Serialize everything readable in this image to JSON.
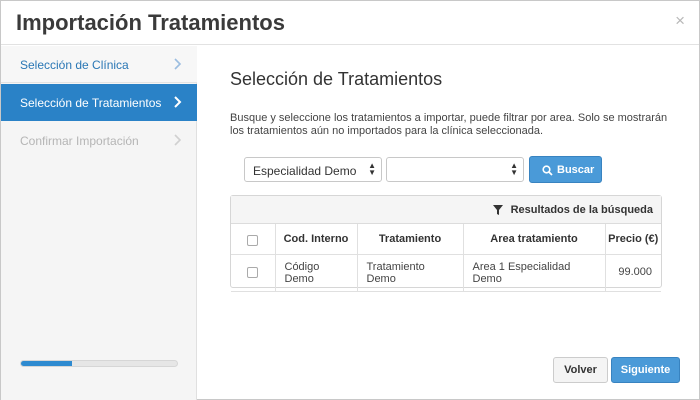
{
  "window": {
    "title": "Importación Tratamientos",
    "close_glyph": "×"
  },
  "sidebar": {
    "steps": [
      {
        "label": "Selección de Clínica",
        "state": "done"
      },
      {
        "label": "Selección de Tratamientos",
        "state": "active"
      },
      {
        "label": "Confirmar Importación",
        "state": "disabled"
      }
    ],
    "progress_percent": 33
  },
  "main": {
    "title": "Selección de Tratamientos",
    "description": "Busque y seleccione los tratamientos a importar, puede filtrar por area. Solo se mostrarán los tratamientos aún no importados para la clínica seleccionada.",
    "filters": {
      "specialty_value": "Especialidad Demo",
      "area_value": "",
      "search_label": "Buscar"
    },
    "results": {
      "header": "Resultados de la búsqueda",
      "columns": [
        "Cod. Interno",
        "Tratamiento",
        "Area tratamiento",
        "Precio (€)"
      ],
      "rows": [
        {
          "code": "Código Demo",
          "treatment": "Tratamiento Demo",
          "area": "Area 1 Especialidad Demo",
          "price": "99.000"
        }
      ]
    }
  },
  "footer": {
    "back_label": "Volver",
    "next_label": "Siguiente"
  },
  "colors": {
    "accent": "#2a82c7",
    "button": "#4a9ad8"
  }
}
